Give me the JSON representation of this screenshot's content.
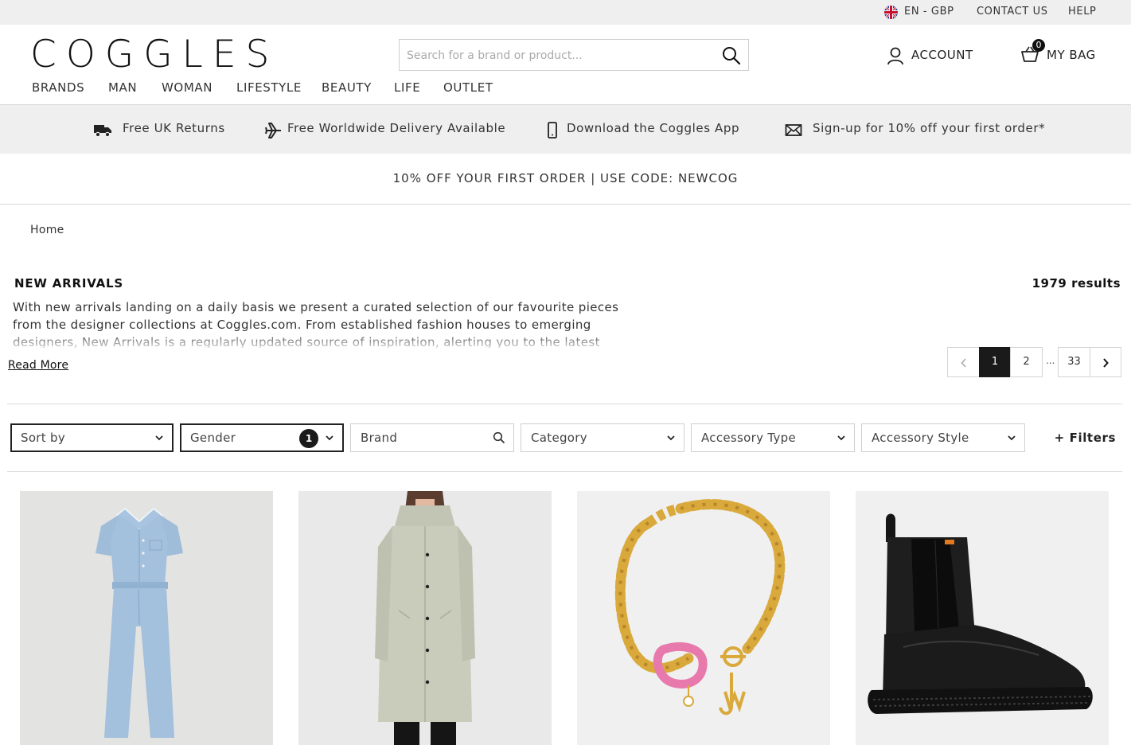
{
  "utility": {
    "language": "EN - GBP",
    "contact": "CONTACT US",
    "help": "HELP"
  },
  "header": {
    "logo": "COGGLES",
    "search_placeholder": "Search for a brand or product...",
    "account_label": "ACCOUNT",
    "bag_label": "MY BAG",
    "bag_count": "0",
    "nav": [
      "BRANDS",
      "MAN",
      "WOMAN",
      "LIFESTYLE",
      "BEAUTY",
      "LIFE",
      "OUTLET"
    ]
  },
  "usp": {
    "returns": "Free UK Returns",
    "delivery": "Free Worldwide Delivery Available",
    "app": "Download the Coggles App",
    "signup": "Sign-up for 10% off your first order*"
  },
  "promo": "10% OFF YOUR FIRST ORDER | USE CODE: NEWCOG",
  "breadcrumb": "Home",
  "listing": {
    "title": "NEW ARRIVALS",
    "results": "1979 results",
    "description": "With new arrivals landing on a daily basis we present a curated selection of our favourite pieces from the designer collections at Coggles.com. From established fashion houses to emerging designers, New Arrivals is a regularly updated source of inspiration, alerting you to the latest",
    "read_more": "Read More"
  },
  "pagination": {
    "pages": [
      "1",
      "2",
      "33"
    ],
    "ellipsis": "...",
    "current": "1"
  },
  "filters": {
    "sort": "Sort by",
    "gender": "Gender",
    "gender_count": "1",
    "brand": "Brand",
    "category": "Category",
    "accessory_type": "Accessory Type",
    "accessory_style": "Accessory Style",
    "more": "+ Filters"
  },
  "products": [
    {
      "image": "denim-jumpsuit"
    },
    {
      "image": "hooded-long-raincoat"
    },
    {
      "image": "gold-chain-necklace-pink-charm"
    },
    {
      "image": "black-chelsea-boot"
    }
  ],
  "colors": {
    "utility_bg": "#efefef",
    "usp_bg": "#efefef",
    "active_page": "#1a1a1a",
    "text": "#222222"
  }
}
